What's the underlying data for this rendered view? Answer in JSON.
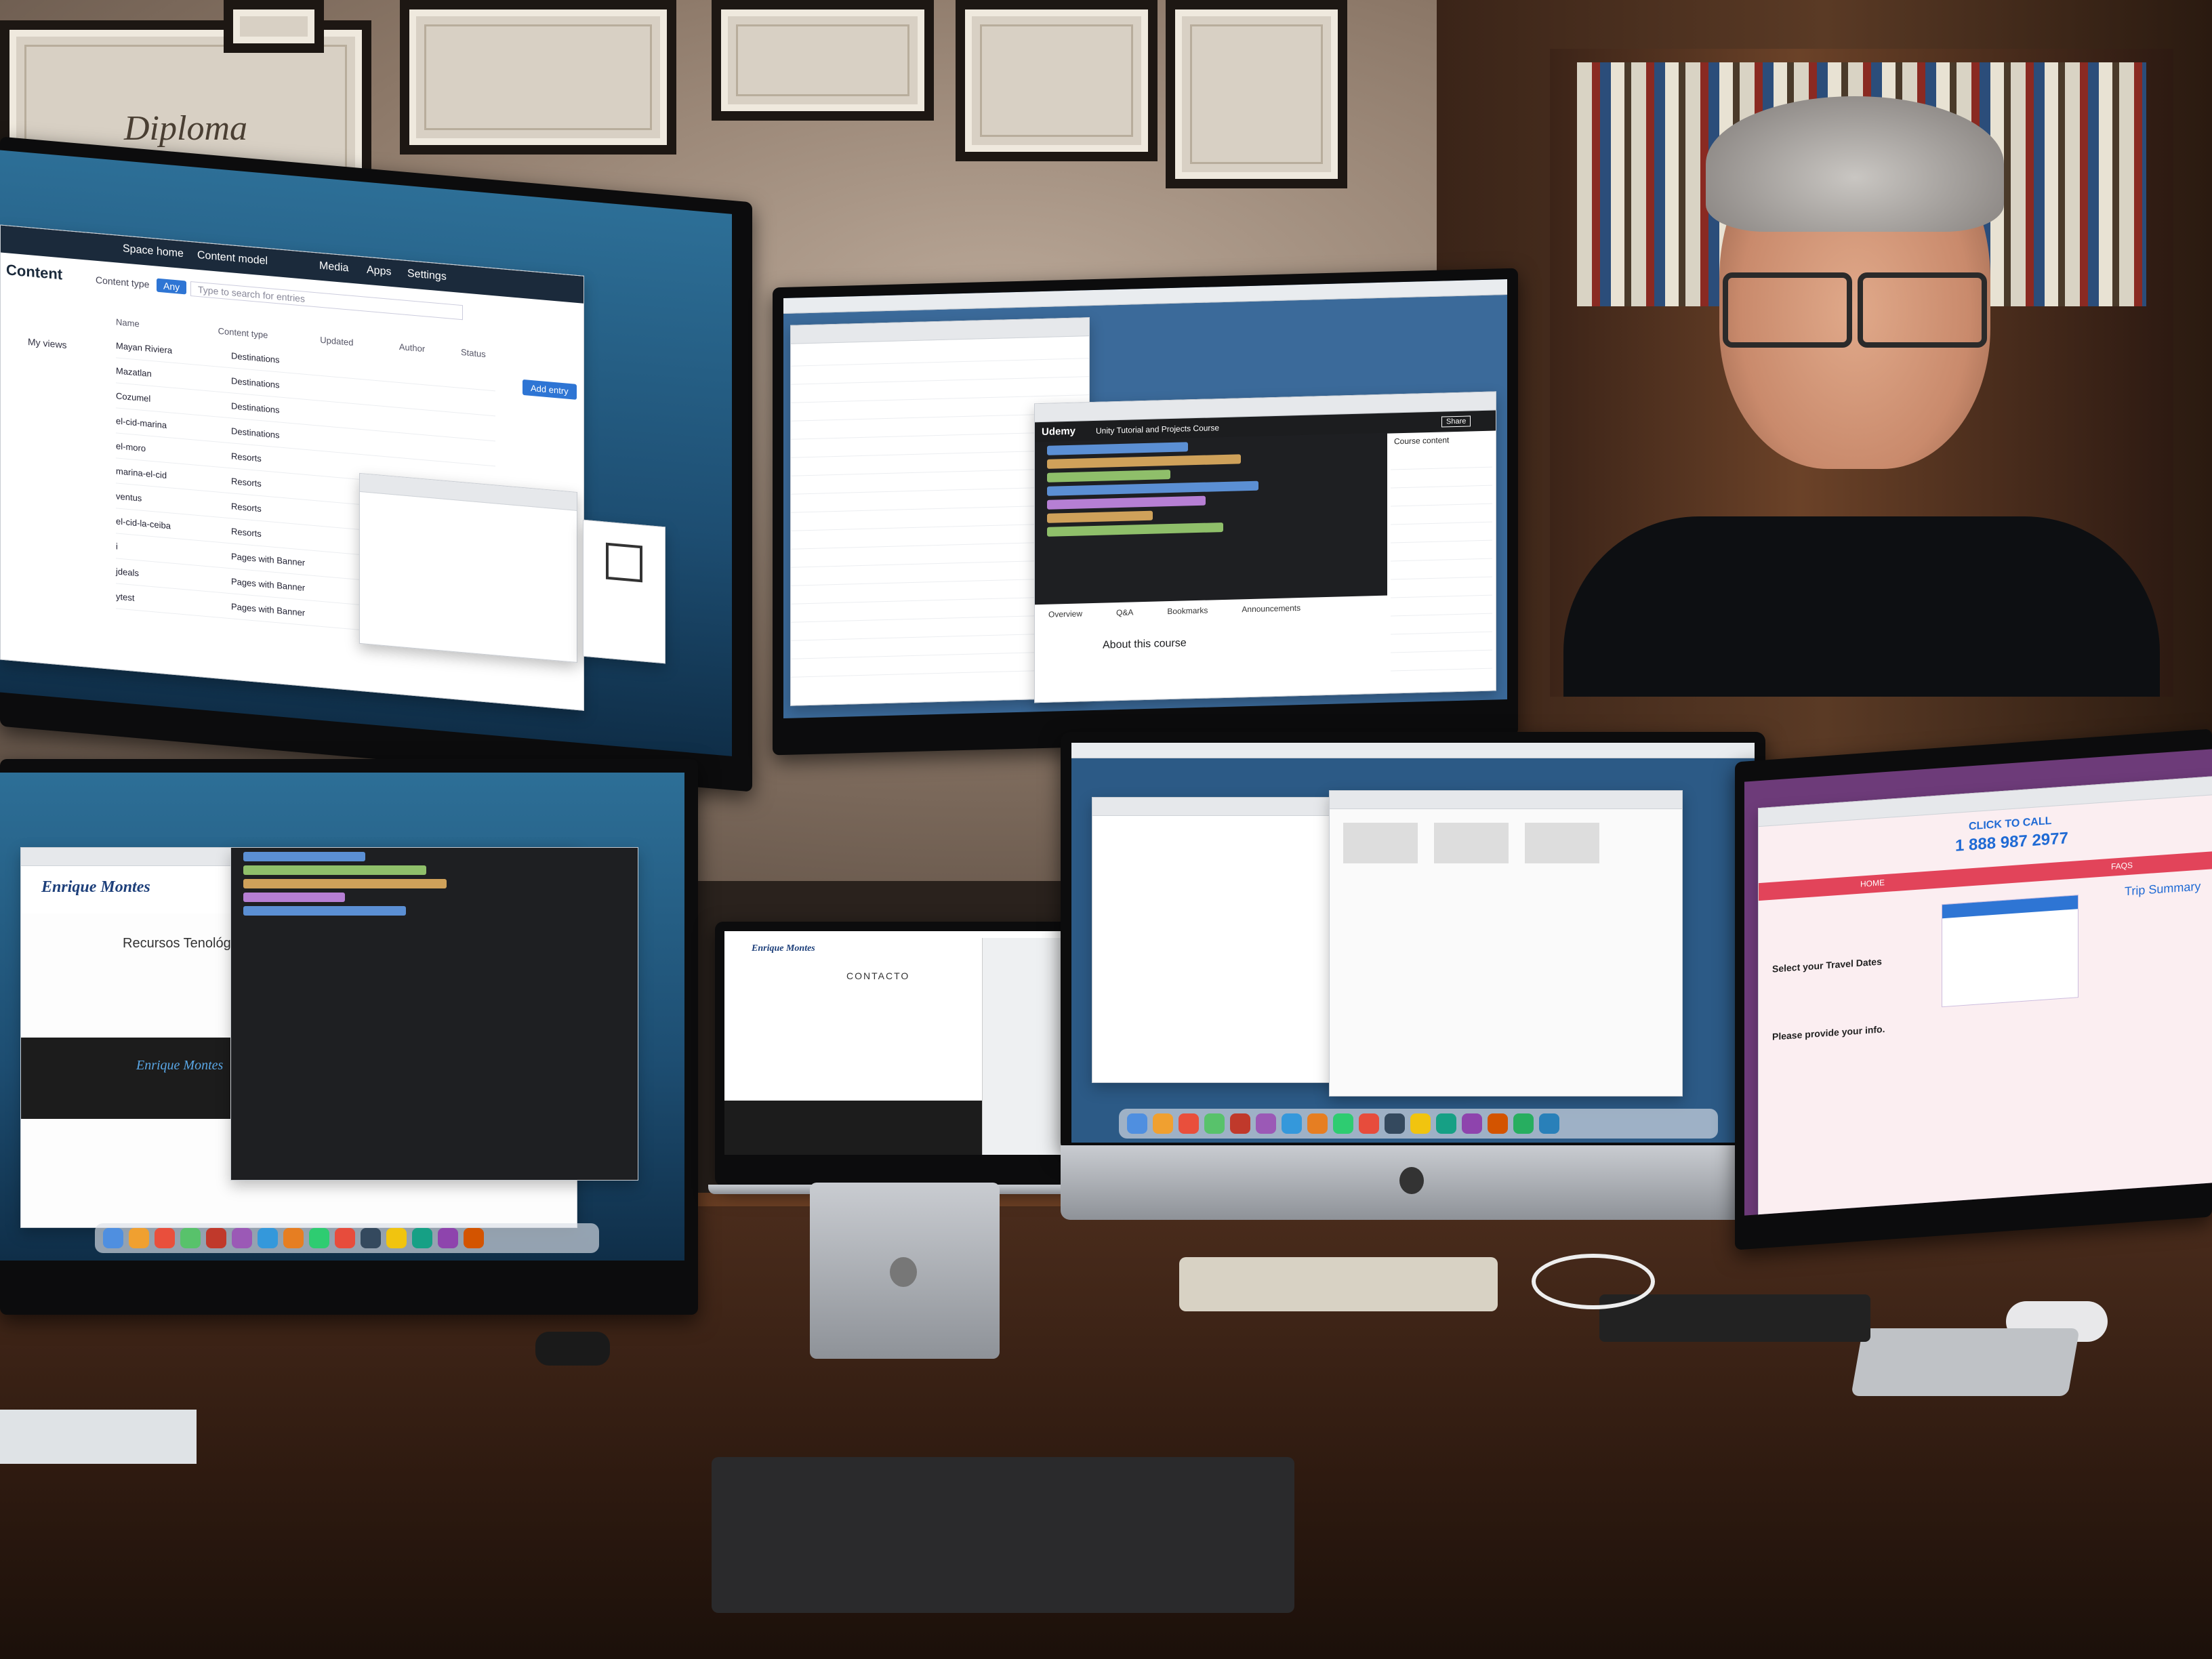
{
  "scene": {
    "wall_color": "#a8968a",
    "desk_color": "#4a2c1c"
  },
  "frames": [
    {
      "id": "diploma",
      "text": "Diploma"
    }
  ],
  "monitor_top_left": {
    "app_header": "Space home",
    "nav_tabs": [
      "Content model",
      "Media",
      "Apps",
      "Settings"
    ],
    "section_title": "Content",
    "search_placeholder": "Type to search for entries",
    "filter_label": "Content type",
    "filter_value": "Any",
    "add_entry_label": "Add entry",
    "columns": [
      "Name",
      "Content type",
      "Updated",
      "Author",
      "Status"
    ],
    "rows": [
      {
        "name": "Mayan Riviera",
        "type": "Destinations"
      },
      {
        "name": "Mazatlan",
        "type": "Destinations"
      },
      {
        "name": "Cozumel",
        "type": "Destinations"
      },
      {
        "name": "el-cid-marina",
        "type": "Destinations"
      },
      {
        "name": "el-moro",
        "type": "Resorts"
      },
      {
        "name": "marina-el-cid",
        "type": "Resorts"
      },
      {
        "name": "ventus",
        "type": "Resorts"
      },
      {
        "name": "el-cid-la-ceiba",
        "type": "Resorts"
      },
      {
        "name": "i",
        "type": "Pages with Banner"
      },
      {
        "name": "jdeals",
        "type": "Pages with Banner"
      },
      {
        "name": "ytest",
        "type": "Pages with Banner"
      }
    ],
    "sidebar_items": [
      "My views"
    ]
  },
  "monitor_top_center": {
    "udemy_logo": "Udemy",
    "course_title": "Unity Tutorial and Projects Course",
    "tabs": [
      "Overview",
      "Q&A",
      "Bookmarks",
      "Announcements"
    ],
    "about_heading": "About this course",
    "course_content_label": "Course content",
    "share_label": "Share"
  },
  "monitor_bottom_left": {
    "brand": "Enrique Montes",
    "page_heading": "Recursos Tenológicos",
    "footer_brand": "Enrique Montes"
  },
  "laptop": {
    "brand": "Enrique Montes",
    "page_heading": "CONTACTO"
  },
  "monitor_bottom_right": {
    "click_to_call": "CLICK TO CALL",
    "phone": "1 888 987 2977",
    "nav_home": "HOME",
    "nav_faqs": "FAQS",
    "travel_dates_label": "Select your Travel Dates",
    "info_label": "Please provide your info.",
    "trip_summary": "Trip Summary"
  },
  "imac": {
    "logo": "apple-logo"
  }
}
